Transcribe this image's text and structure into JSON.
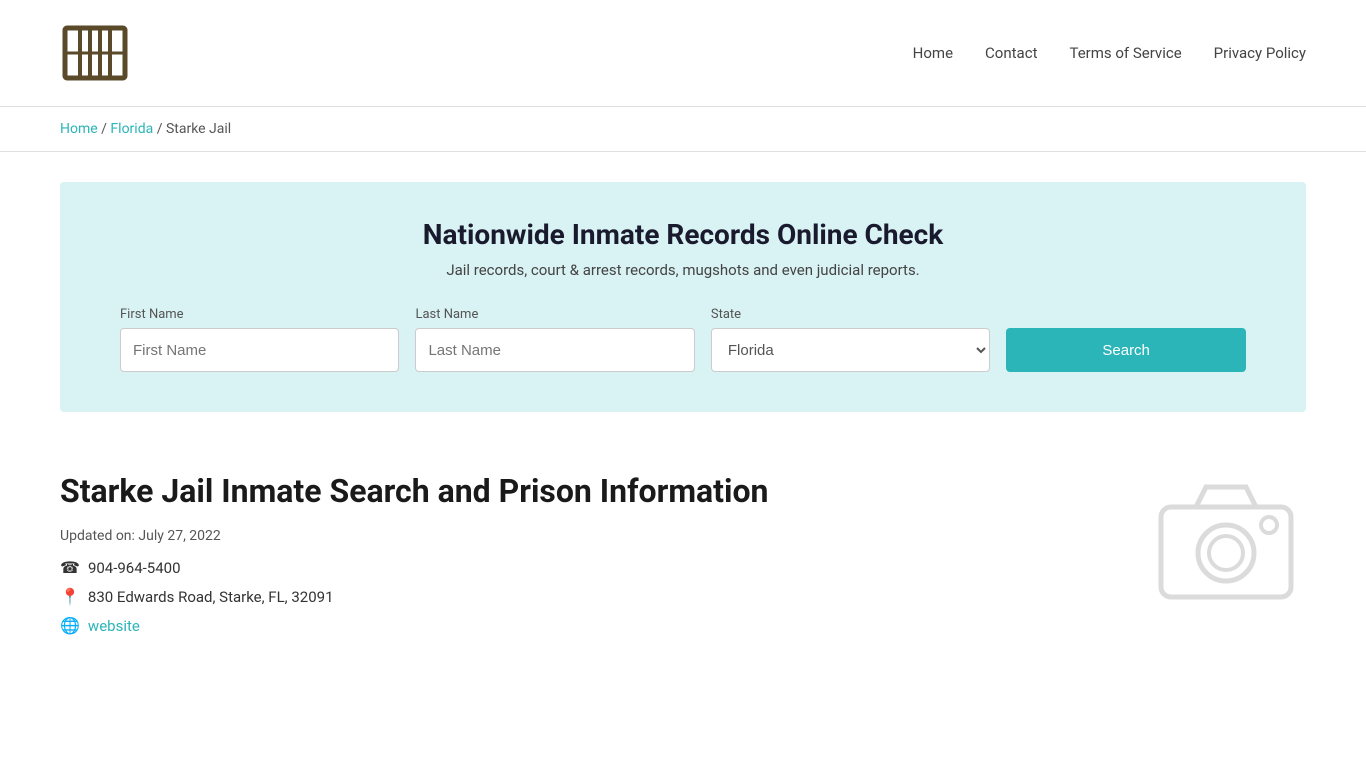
{
  "header": {
    "logo_alt": "Jail Records Logo",
    "nav": {
      "home_label": "Home",
      "contact_label": "Contact",
      "tos_label": "Terms of Service",
      "privacy_label": "Privacy Policy"
    }
  },
  "breadcrumb": {
    "home": "Home",
    "state": "Florida",
    "current": "Starke Jail"
  },
  "search_banner": {
    "title": "Nationwide Inmate Records Online Check",
    "subtitle": "Jail records, court & arrest records, mugshots and even judicial reports.",
    "first_name_label": "First Name",
    "first_name_placeholder": "First Name",
    "last_name_label": "Last Name",
    "last_name_placeholder": "Last Name",
    "state_label": "State",
    "state_value": "Florida",
    "search_button": "Search"
  },
  "main": {
    "page_title": "Starke Jail Inmate Search and Prison Information",
    "updated_on": "Updated on: July 27, 2022",
    "phone": "904-964-5400",
    "address": "830 Edwards Road, Starke, FL, 32091",
    "website_label": "website",
    "website_url": "#"
  }
}
